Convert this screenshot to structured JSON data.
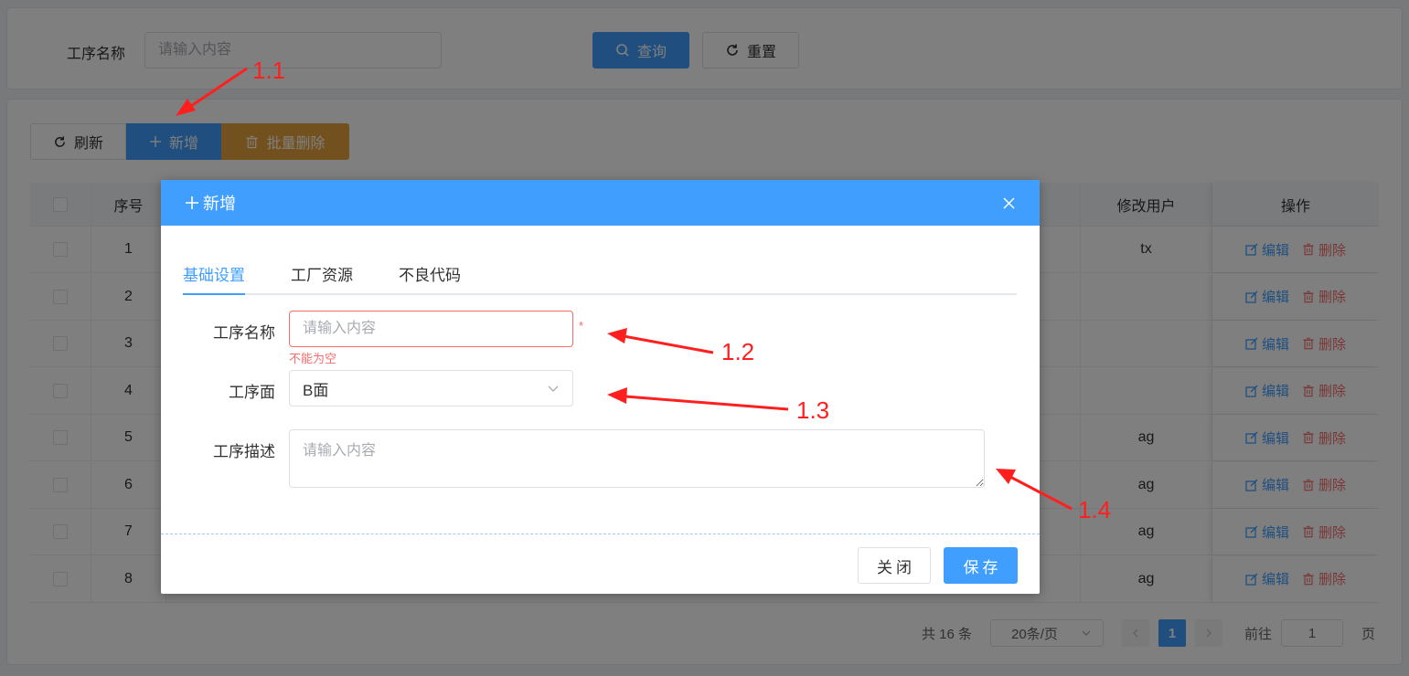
{
  "search": {
    "label": "工序名称",
    "placeholder": "请输入内容",
    "query_label": "查询",
    "reset_label": "重置"
  },
  "toolbar": {
    "refresh_label": "刷新",
    "add_label": "新增",
    "batch_delete_label": "批量删除"
  },
  "table": {
    "headers": {
      "index": "序号",
      "modified_user": "修改用户",
      "actions": "操作"
    },
    "rows": [
      {
        "index": "1",
        "user": "tx"
      },
      {
        "index": "2",
        "user": ""
      },
      {
        "index": "3",
        "user": ""
      },
      {
        "index": "4",
        "user": ""
      },
      {
        "index": "5",
        "user": "ag"
      },
      {
        "index": "6",
        "user": "ag"
      },
      {
        "index": "7",
        "user": "ag"
      },
      {
        "index": "8",
        "user": "ag"
      }
    ],
    "edit_label": "编辑",
    "delete_label": "删除"
  },
  "pagination": {
    "total_label": "共 16 条",
    "page_size": "20条/页",
    "current_page": "1",
    "goto_label": "前往",
    "goto_value": "1",
    "page_unit": "页"
  },
  "dialog": {
    "title": "新增",
    "tabs": [
      "基础设置",
      "工厂资源",
      "不良代码"
    ],
    "active_tab": "基础设置",
    "fields": {
      "name_label": "工序名称",
      "name_placeholder": "请输入内容",
      "name_error": "不能为空",
      "required_mark": "*",
      "side_label": "工序面",
      "side_value": "B面",
      "desc_label": "工序描述",
      "desc_placeholder": "请输入内容"
    },
    "close_label": "关闭",
    "save_label": "保存"
  },
  "annotations": [
    "1.1",
    "1.2",
    "1.3",
    "1.4"
  ],
  "colors": {
    "primary": "#409eff",
    "warning": "#e6a23c",
    "danger": "#f56c6c",
    "annotation": "#ff1f1f"
  }
}
